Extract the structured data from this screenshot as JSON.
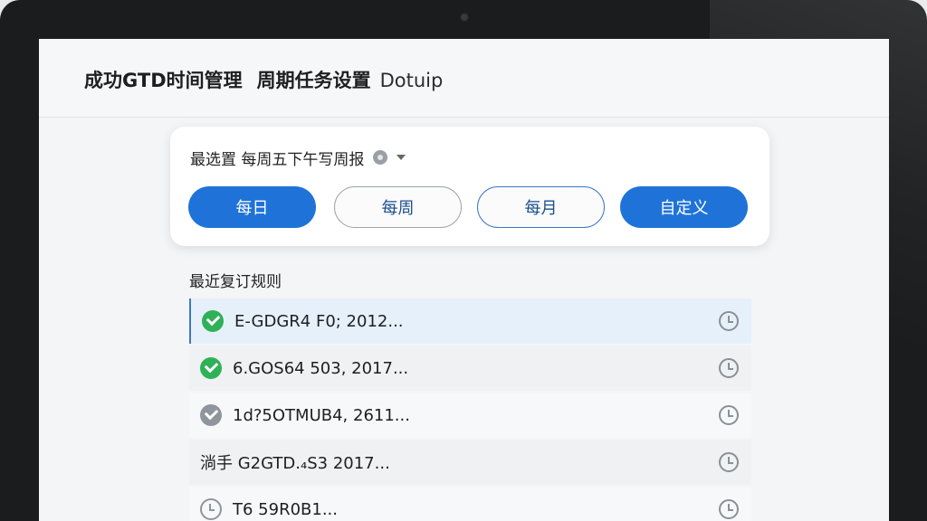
{
  "header": {
    "title": "成功GTD时间管理",
    "subtitle": "周期任务设置",
    "brand": "Dotuip"
  },
  "preset": {
    "label": "最选置 每周五下午写周报"
  },
  "frequency_buttons": [
    {
      "label": "每日",
      "state": "active"
    },
    {
      "label": "每周",
      "state": "default"
    },
    {
      "label": "每月",
      "state": "outlined"
    },
    {
      "label": "自定义",
      "state": "active"
    }
  ],
  "recent": {
    "title": "最近复订规则",
    "items": [
      {
        "text": "E-GDGR4 F0; 2012...",
        "status": "done"
      },
      {
        "text": "6.GOS64 503, 2017...",
        "status": "done"
      },
      {
        "text": "1d?5OTMUB4, 2611...",
        "status": "muted"
      },
      {
        "text": "淌手 G2GTD.₄S3 2017...",
        "status": "none"
      },
      {
        "text": "T6 59R0B1...",
        "status": "clock"
      }
    ]
  },
  "colors": {
    "primary": "#1f73d8",
    "success": "#2fb157",
    "muted": "#8f959c"
  }
}
